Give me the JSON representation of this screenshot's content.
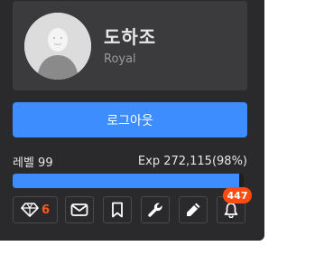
{
  "user": {
    "name": "도하조",
    "grade": "Royal",
    "avatar_icon": "default-person-avatar"
  },
  "logout_label": "로그아웃",
  "level": {
    "label": "레벨 99",
    "exp_text": "Exp 272,115(98%)",
    "progress_percent": 98
  },
  "toolbar": {
    "gem_count": "6",
    "notification_count": "447",
    "icons": [
      "diamond-icon",
      "mail-icon",
      "bookmark-icon",
      "wrench-icon",
      "pencil-icon",
      "bell-icon"
    ]
  },
  "colors": {
    "panel_bg": "#2a2a2c",
    "card_bg": "#3b3b3e",
    "accent": "#3d8dff",
    "badge": "#ff4a12",
    "gem_count": "#ff5a1f"
  }
}
